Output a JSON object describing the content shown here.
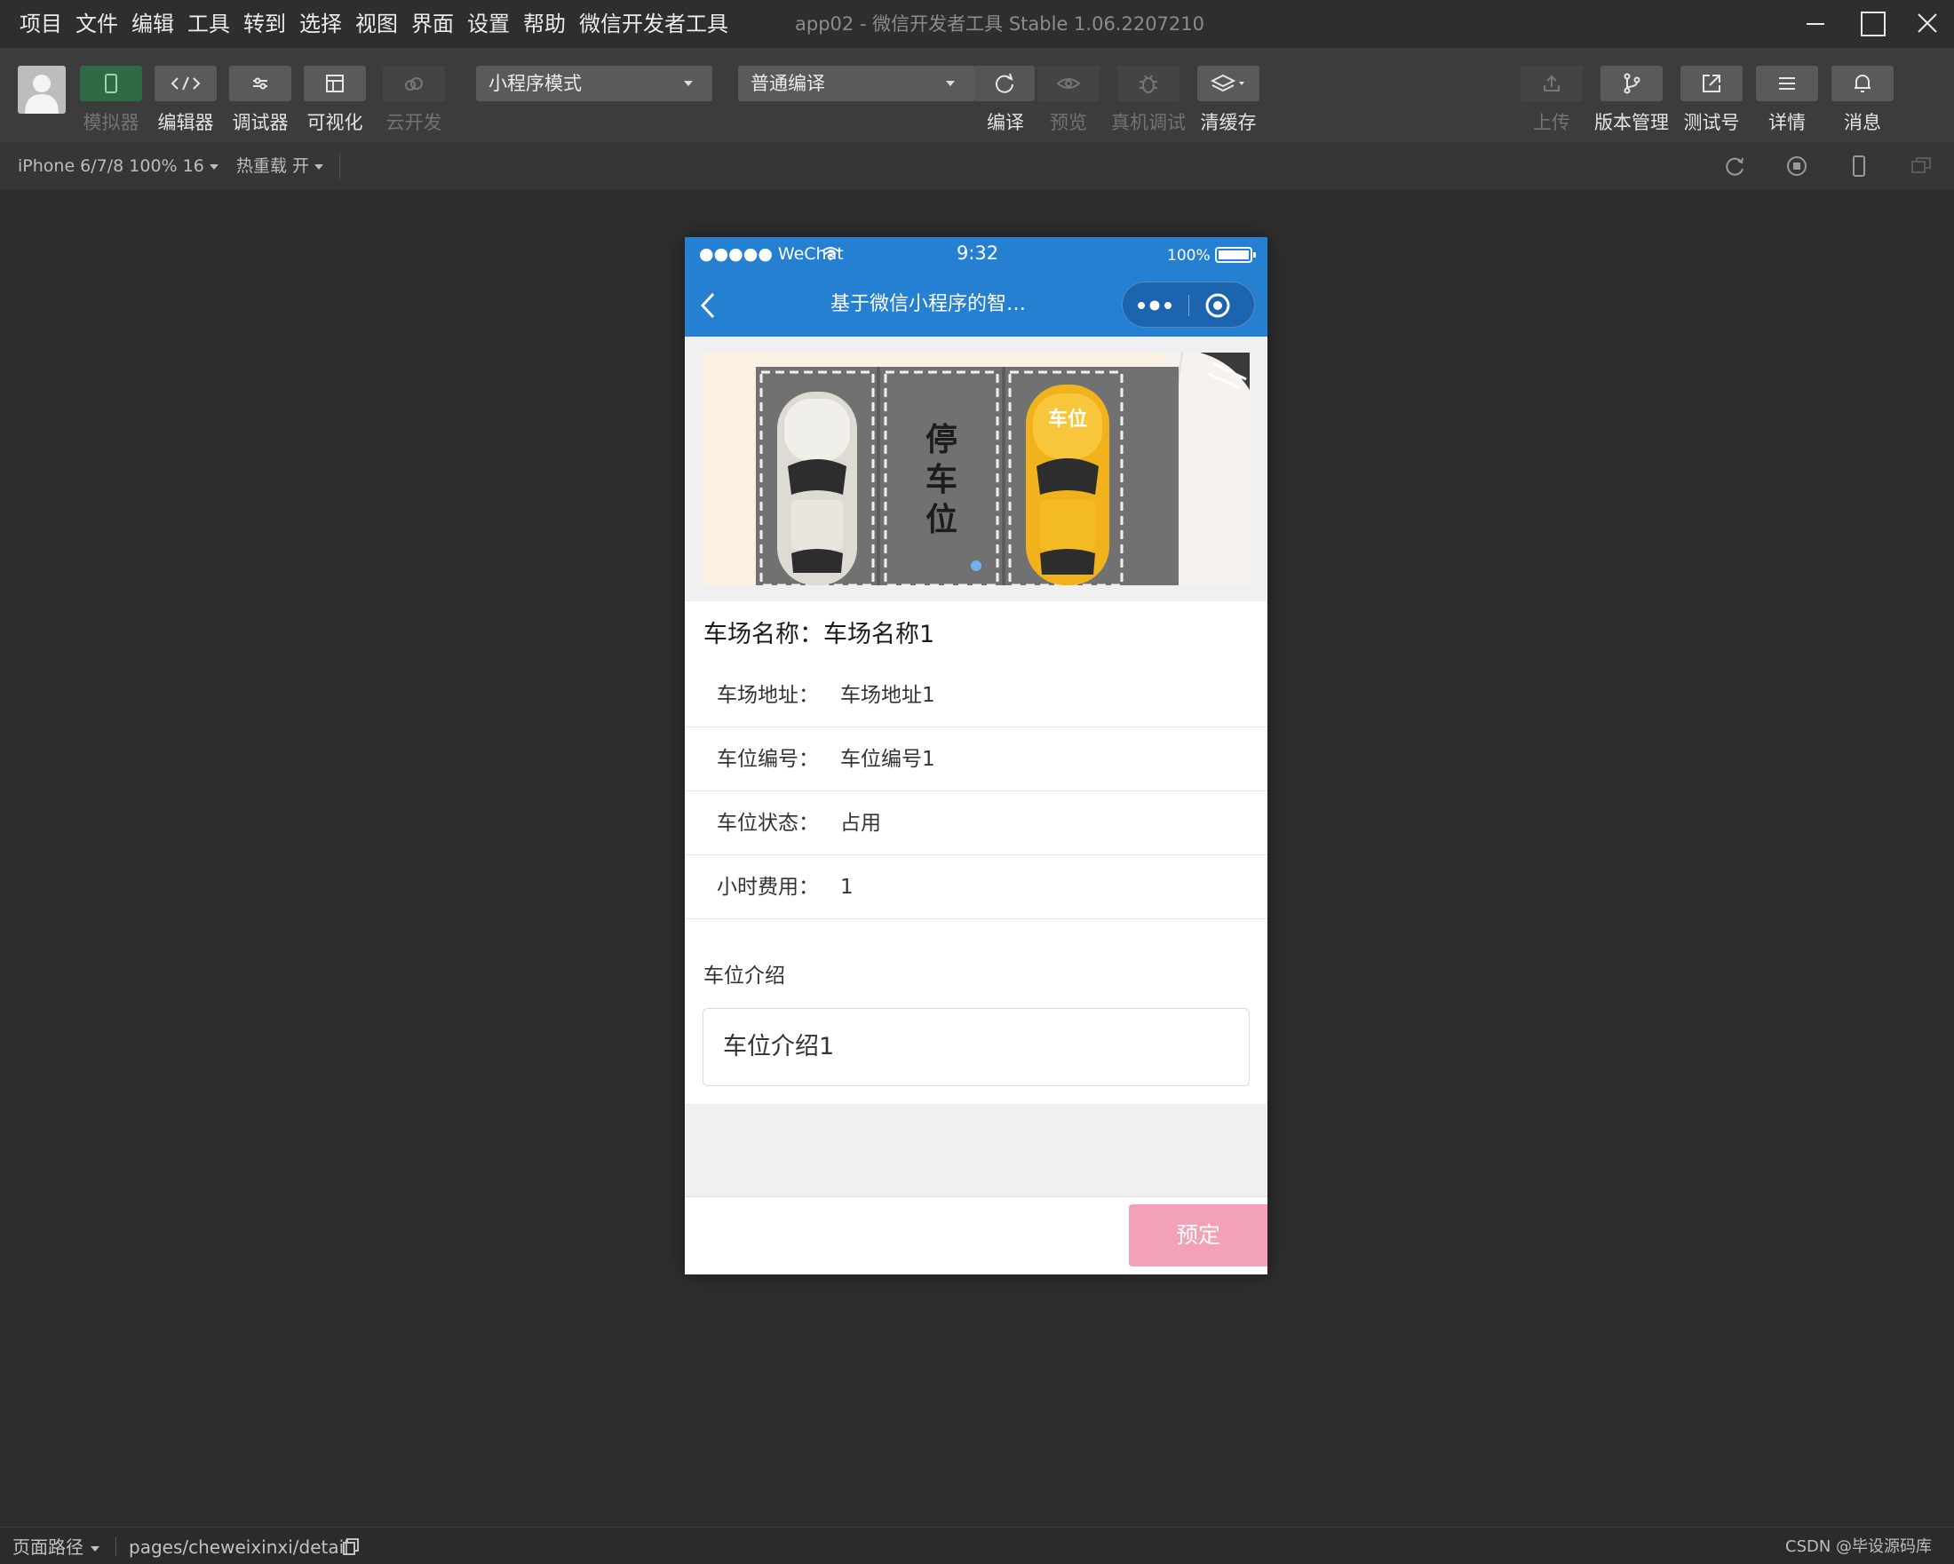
{
  "menubar": {
    "items": [
      "项目",
      "文件",
      "编辑",
      "工具",
      "转到",
      "选择",
      "视图",
      "界面",
      "设置",
      "帮助",
      "微信开发者工具"
    ],
    "window_title": "app02 - 微信开发者工具 Stable 1.06.2207210"
  },
  "toolbar": {
    "simulator": "模拟器",
    "editor": "编辑器",
    "debugger": "调试器",
    "visual": "可视化",
    "cloud": "云开发",
    "mode_select": "小程序模式",
    "compile_select": "普通编译",
    "compile": "编译",
    "preview": "预览",
    "real_debug": "真机调试",
    "clear_cache": "清缓存",
    "upload": "上传",
    "version": "版本管理",
    "test_account": "测试号",
    "details": "详情",
    "messages": "消息"
  },
  "subbar": {
    "device": "iPhone 6/7/8 100% 16",
    "hot_reload": "热重载 开"
  },
  "phone": {
    "status": {
      "carrier": "●●●●● WeChat",
      "time": "9:32",
      "battery": "100%"
    },
    "nav_title": "基于微信小程序的智能停车场...",
    "banner": {
      "slot_text": [
        "停",
        "车",
        "位"
      ],
      "taxi_sign": "车位"
    },
    "lot_title": "车场名称：车场名称1",
    "fields": [
      {
        "label": "车场地址：",
        "value": "车场地址1"
      },
      {
        "label": "车位编号：",
        "value": "车位编号1"
      },
      {
        "label": "车位状态：",
        "value": "占用"
      },
      {
        "label": "小时费用：",
        "value": "1"
      }
    ],
    "intro_label": "车位介绍",
    "intro_value": "车位介绍1",
    "book_button": "预定"
  },
  "footer": {
    "path_label": "页面路径",
    "path": "pages/cheweixinxi/detail",
    "watermark": "CSDN @毕设源码库"
  },
  "colors": {
    "wechat_blue": "#2680d2",
    "book_pink": "#f2a1b6",
    "simulator_green": "#2e6b45"
  }
}
